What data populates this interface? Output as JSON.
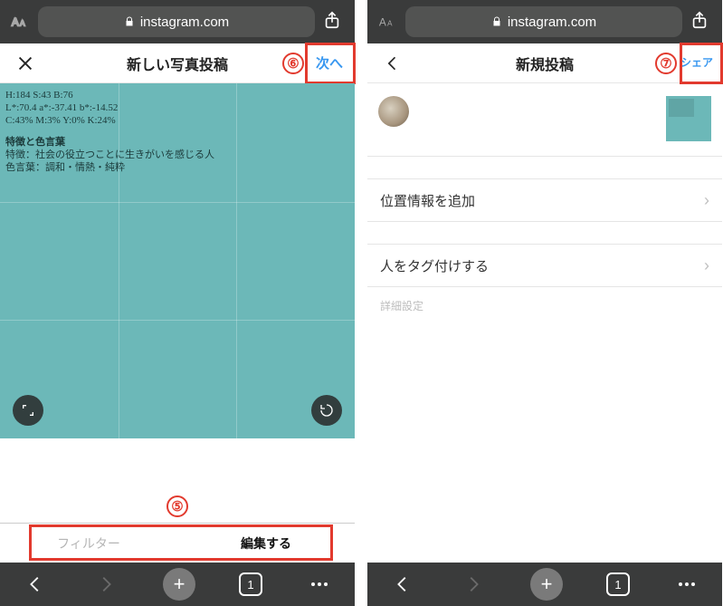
{
  "safari": {
    "url": "instagram.com",
    "tab_count": "1"
  },
  "left": {
    "header_title": "新しい写真投稿",
    "next_label": "次へ",
    "badge6": "⑥",
    "badge5": "⑤",
    "preview_lines": {
      "l1": "H:184 S:43 B:76",
      "l2": "L*:70.4 a*:-37.41 b*:-14.52",
      "l3": "C:43% M:3% Y:0% K:24%",
      "h1": "特徴と色言葉",
      "l4": "特徴：社会の役立つことに生きがいを感じる人",
      "l5": "色言葉：調和・情熱・純粋"
    },
    "tabs": {
      "filter": "フィルター",
      "edit": "編集する"
    }
  },
  "right": {
    "header_title": "新規投稿",
    "share_label": "シェア",
    "badge7": "⑦",
    "menu": {
      "location": "位置情報を追加",
      "tag_people": "人をタグ付けする",
      "advanced": "詳細設定"
    }
  }
}
